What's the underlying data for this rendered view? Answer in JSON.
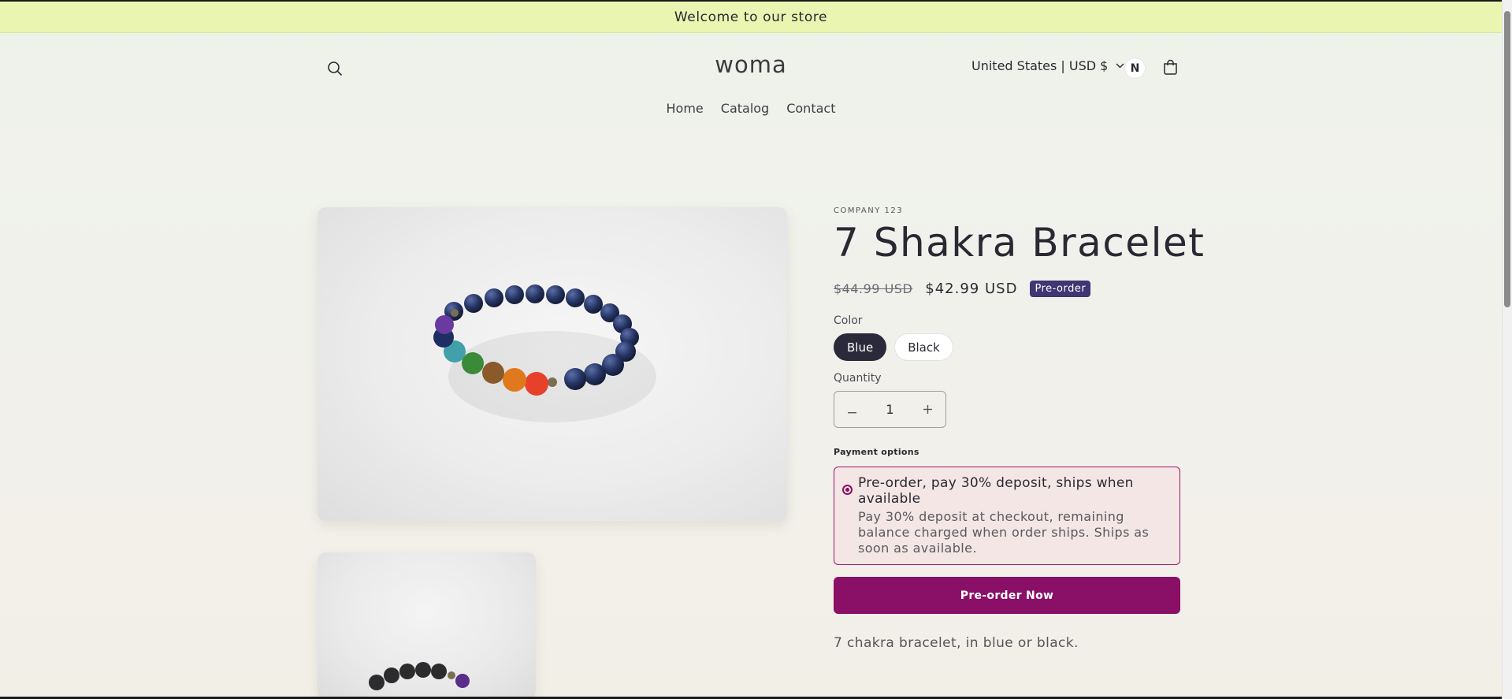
{
  "announcement": "Welcome to our store",
  "header": {
    "logo": "woma",
    "country_selector": "United States | USD $",
    "avatar_initial": "N"
  },
  "nav": {
    "items": [
      "Home",
      "Catalog",
      "Contact"
    ]
  },
  "product": {
    "vendor": "COMPANY 123",
    "title": "7 Shakra Bracelet",
    "compare_price": "$44.99 USD",
    "price": "$42.99 USD",
    "badge": "Pre-order",
    "color_label": "Color",
    "colors": [
      "Blue",
      "Black"
    ],
    "selected_color": "Blue",
    "quantity_label": "Quantity",
    "quantity": "1",
    "payment_label": "Payment options",
    "payment_option": {
      "title": "Pre-order, pay 30% deposit, ships when available",
      "description": "Pay 30% deposit at checkout, remaining balance charged when order ships. Ships as soon as available."
    },
    "cta": "Pre-order Now",
    "description": "7 chakra bracelet, in blue or black."
  },
  "colors": {
    "announcement_bg": "#e9f5b0",
    "accent": "#8a0f67",
    "badge": "#3f3673",
    "selected_swatch": "#2b2a3a"
  },
  "icons": {
    "search": "search-icon",
    "chevron": "chevron-down-icon",
    "cart": "cart-icon",
    "minus": "minus-icon",
    "plus": "plus-icon"
  }
}
